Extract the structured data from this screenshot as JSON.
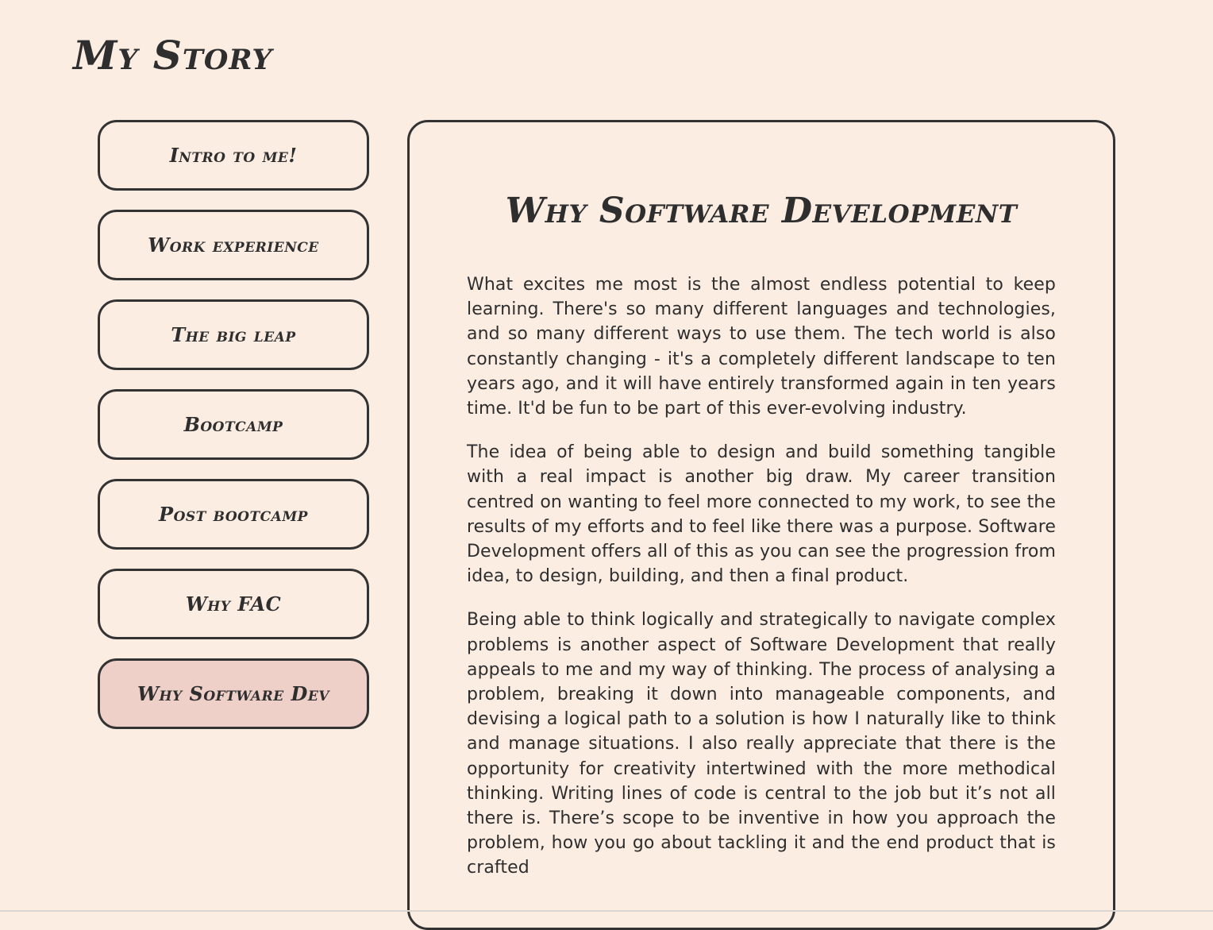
{
  "header": {
    "title": "My Story"
  },
  "nav": {
    "items": [
      {
        "label": "Intro to me!",
        "active": false
      },
      {
        "label": "Work experience",
        "active": false
      },
      {
        "label": "The big leap",
        "active": false
      },
      {
        "label": "Bootcamp",
        "active": false
      },
      {
        "label": "Post bootcamp",
        "active": false
      },
      {
        "label": "Why FAC",
        "active": false
      },
      {
        "label": "Why Software Dev",
        "active": true
      }
    ]
  },
  "content": {
    "title": "Why Software Development",
    "paragraphs": [
      "What excites me most is the almost endless potential to keep learning. There's so many different languages and technologies, and so many different ways to use them. The tech world is also constantly changing - it's a completely different landscape to ten years ago, and it will have entirely transformed again in ten years time. It'd be fun to be part of this ever-evolving industry.",
      "The idea of being able to design and build something tangible with a real impact is another big draw. My career transition centred on wanting to feel more connected to my work, to see the results of my efforts and to feel like there was a purpose. Software Development offers all of this as you can see the progression from idea, to design, building, and then a final product.",
      "Being able to think logically and strategically to navigate complex problems is another aspect of Software Development that really appeals to me and my way of thinking. The process of analysing a problem, breaking it down into manageable components, and devising a logical path to a solution is how I naturally like to think and manage situations. I also really appreciate that there is the opportunity for creativity intertwined with the more methodical thinking. Writing lines of code is central to the job but it’s not all there is. There’s scope to be inventive in how you approach the problem, how you go about tackling it and the end product that is crafted"
    ]
  },
  "colors": {
    "background": "#fcede3",
    "text": "#2e2e2e",
    "border": "#333333",
    "active_button": "#efd0c8"
  }
}
